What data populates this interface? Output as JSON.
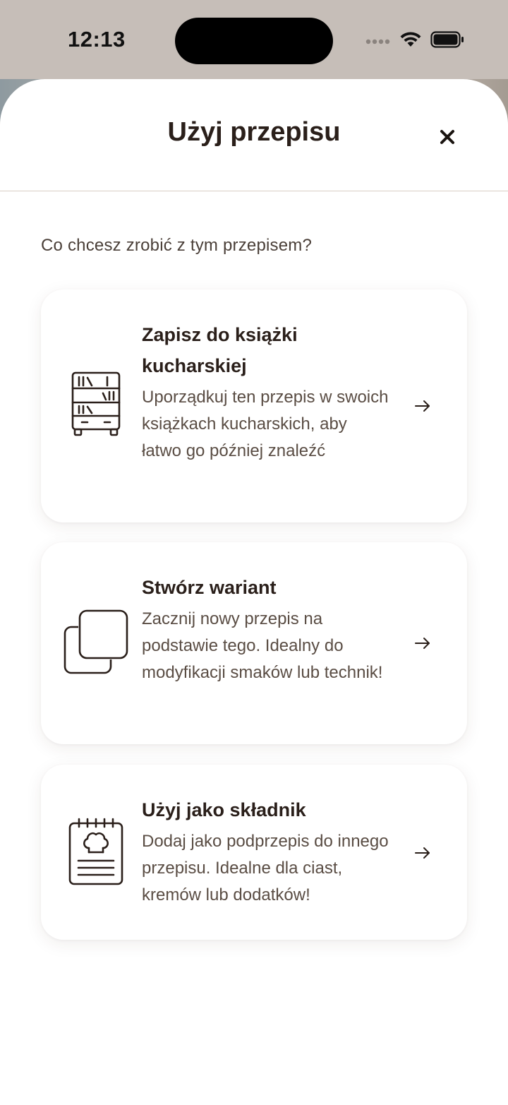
{
  "status_bar": {
    "time": "12:13"
  },
  "sheet": {
    "title": "Użyj przepisu",
    "prompt": "Co chcesz zrobić z tym przepisem?"
  },
  "options": [
    {
      "title": "Zapisz do książki kucharskiej",
      "description": "Uporządkuj ten przepis w swoich książkach kucharskich, aby łatwo go później znaleźć",
      "icon": "bookshelf-icon"
    },
    {
      "title": "Stwórz wariant",
      "description": "Zacznij nowy przepis na podstawie tego. Idealny do modyfikacji smaków lub technik!",
      "icon": "duplicate-icon"
    },
    {
      "title": "Użyj jako składnik",
      "description": "Dodaj jako podprzepis do innego przepisu. Idealne dla ciast, kremów lub dodatków!",
      "icon": "recipe-notepad-icon"
    }
  ],
  "colors": {
    "text_primary": "#2a1f1a",
    "text_secondary": "#5a4d44",
    "divider": "#d8cdc4",
    "status_bar_bg": "#c6beb8"
  }
}
